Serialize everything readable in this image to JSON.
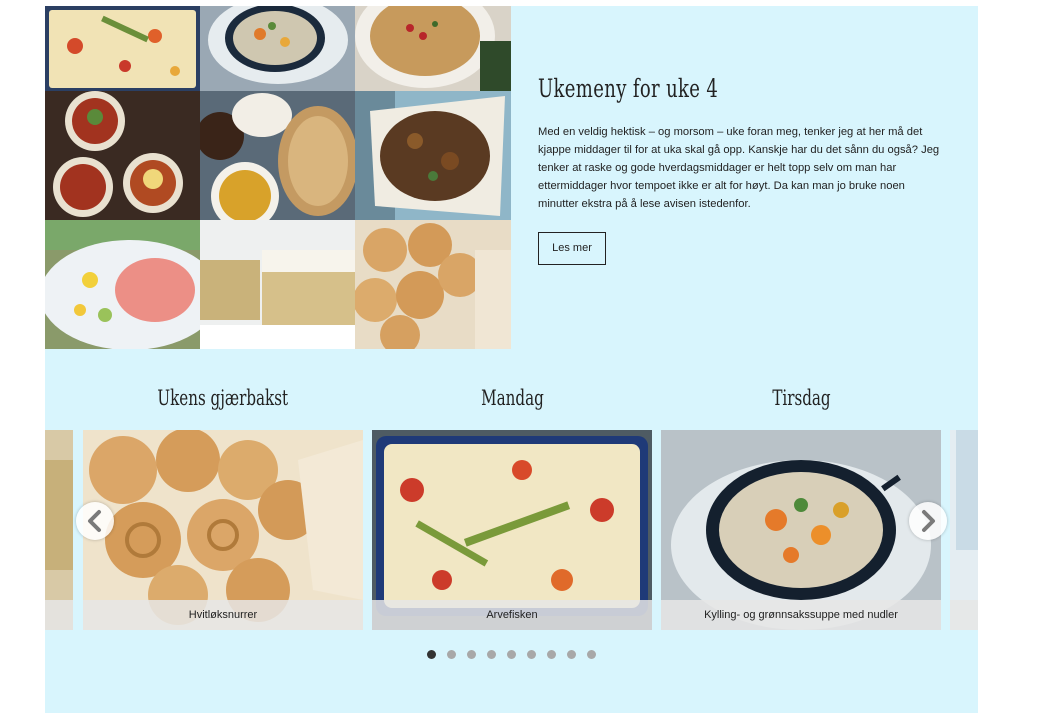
{
  "intro": {
    "title": "Ukemeny for uke 4",
    "text": "Med en veldig hektisk – og morsom – uke foran meg, tenker jeg at her må det kjappe middager til for at uka skal gå opp. Kanskje har du det sånn du også? Jeg tenker at raske og gode hverdagsmiddager er helt topp selv om man har ettermiddager hvor tempoet ikke er alt for høyt. Da kan man jo bruke noen minutter ekstra på å lese avisen istedenfor.",
    "button_label": "Les mer"
  },
  "mosaic": {
    "images": [
      "fish-casserole-photo",
      "chicken-soup-photo",
      "risotto-photo",
      "chili-bowls-photo",
      "dal-and-flatbread-photo",
      "baked-vegetables-photo",
      "salmon-platter-photo",
      "lemon-cake-photo",
      "garlic-buns-photo"
    ]
  },
  "carousel": {
    "headings": [
      "Ukens gjærbakst",
      "Mandag",
      "Tirsdag"
    ],
    "cards": [
      {
        "caption": "Hvitløksnurrer"
      },
      {
        "caption": "Arvefisken"
      },
      {
        "caption": "Kylling- og grønnsakssuppe med nudler"
      }
    ],
    "prev_icon": "chevron-left-icon",
    "next_icon": "chevron-right-icon",
    "page_count": 9,
    "active_page": 1
  },
  "colors": {
    "panel_bg": "#d8f5fd",
    "text": "#222222",
    "dot_active": "#333333",
    "dot_inactive": "#a8a8a8"
  }
}
